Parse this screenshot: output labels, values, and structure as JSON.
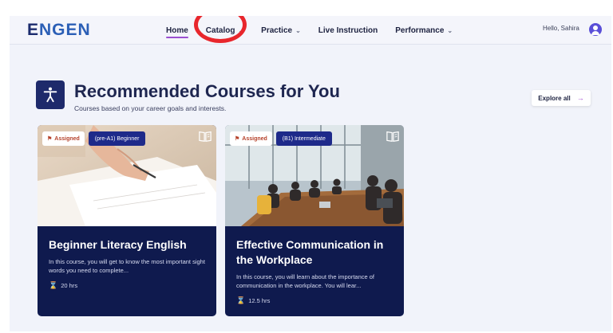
{
  "header": {
    "logo": "ENGEN",
    "nav": [
      {
        "label": "Home",
        "has_menu": false,
        "active": true
      },
      {
        "label": "Catalog",
        "has_menu": true,
        "active": false
      },
      {
        "label": "Practice",
        "has_menu": true,
        "active": false
      },
      {
        "label": "Live Instruction",
        "has_menu": false,
        "active": false
      },
      {
        "label": "Performance",
        "has_menu": true,
        "active": false
      }
    ],
    "greeting": "Hello, Sahira",
    "highlight_color": "#e8262c",
    "active_color": "#9b4fd0"
  },
  "section": {
    "icon": "person-accessibility-icon",
    "title": "Recommended Courses for You",
    "subtitle": "Courses based on your career goals and interests.",
    "explore_label": "Explore all",
    "explore_icon": "arrow-right-icon"
  },
  "courses": [
    {
      "badge": "Assigned",
      "level": "(pre-A1) Beginner",
      "title": "Beginner Literacy English",
      "description": "In this course, you will get to know the most important sight words you need to complete...",
      "duration": "20 hrs",
      "image": "hand-writing-on-paper"
    },
    {
      "badge": "Assigned",
      "level": "(B1) Intermediate",
      "title": "Effective Communication in the Workplace",
      "description": "In this course, you will learn about the importance of communication in the workplace. You will lear...",
      "duration": "12.5 hrs",
      "image": "office-meeting-room"
    }
  ],
  "colors": {
    "brand_dark": "#1e2a6b",
    "card_bg": "#0f1a4e",
    "level_badge": "#1e2a8a",
    "assigned_text": "#b5412a"
  }
}
